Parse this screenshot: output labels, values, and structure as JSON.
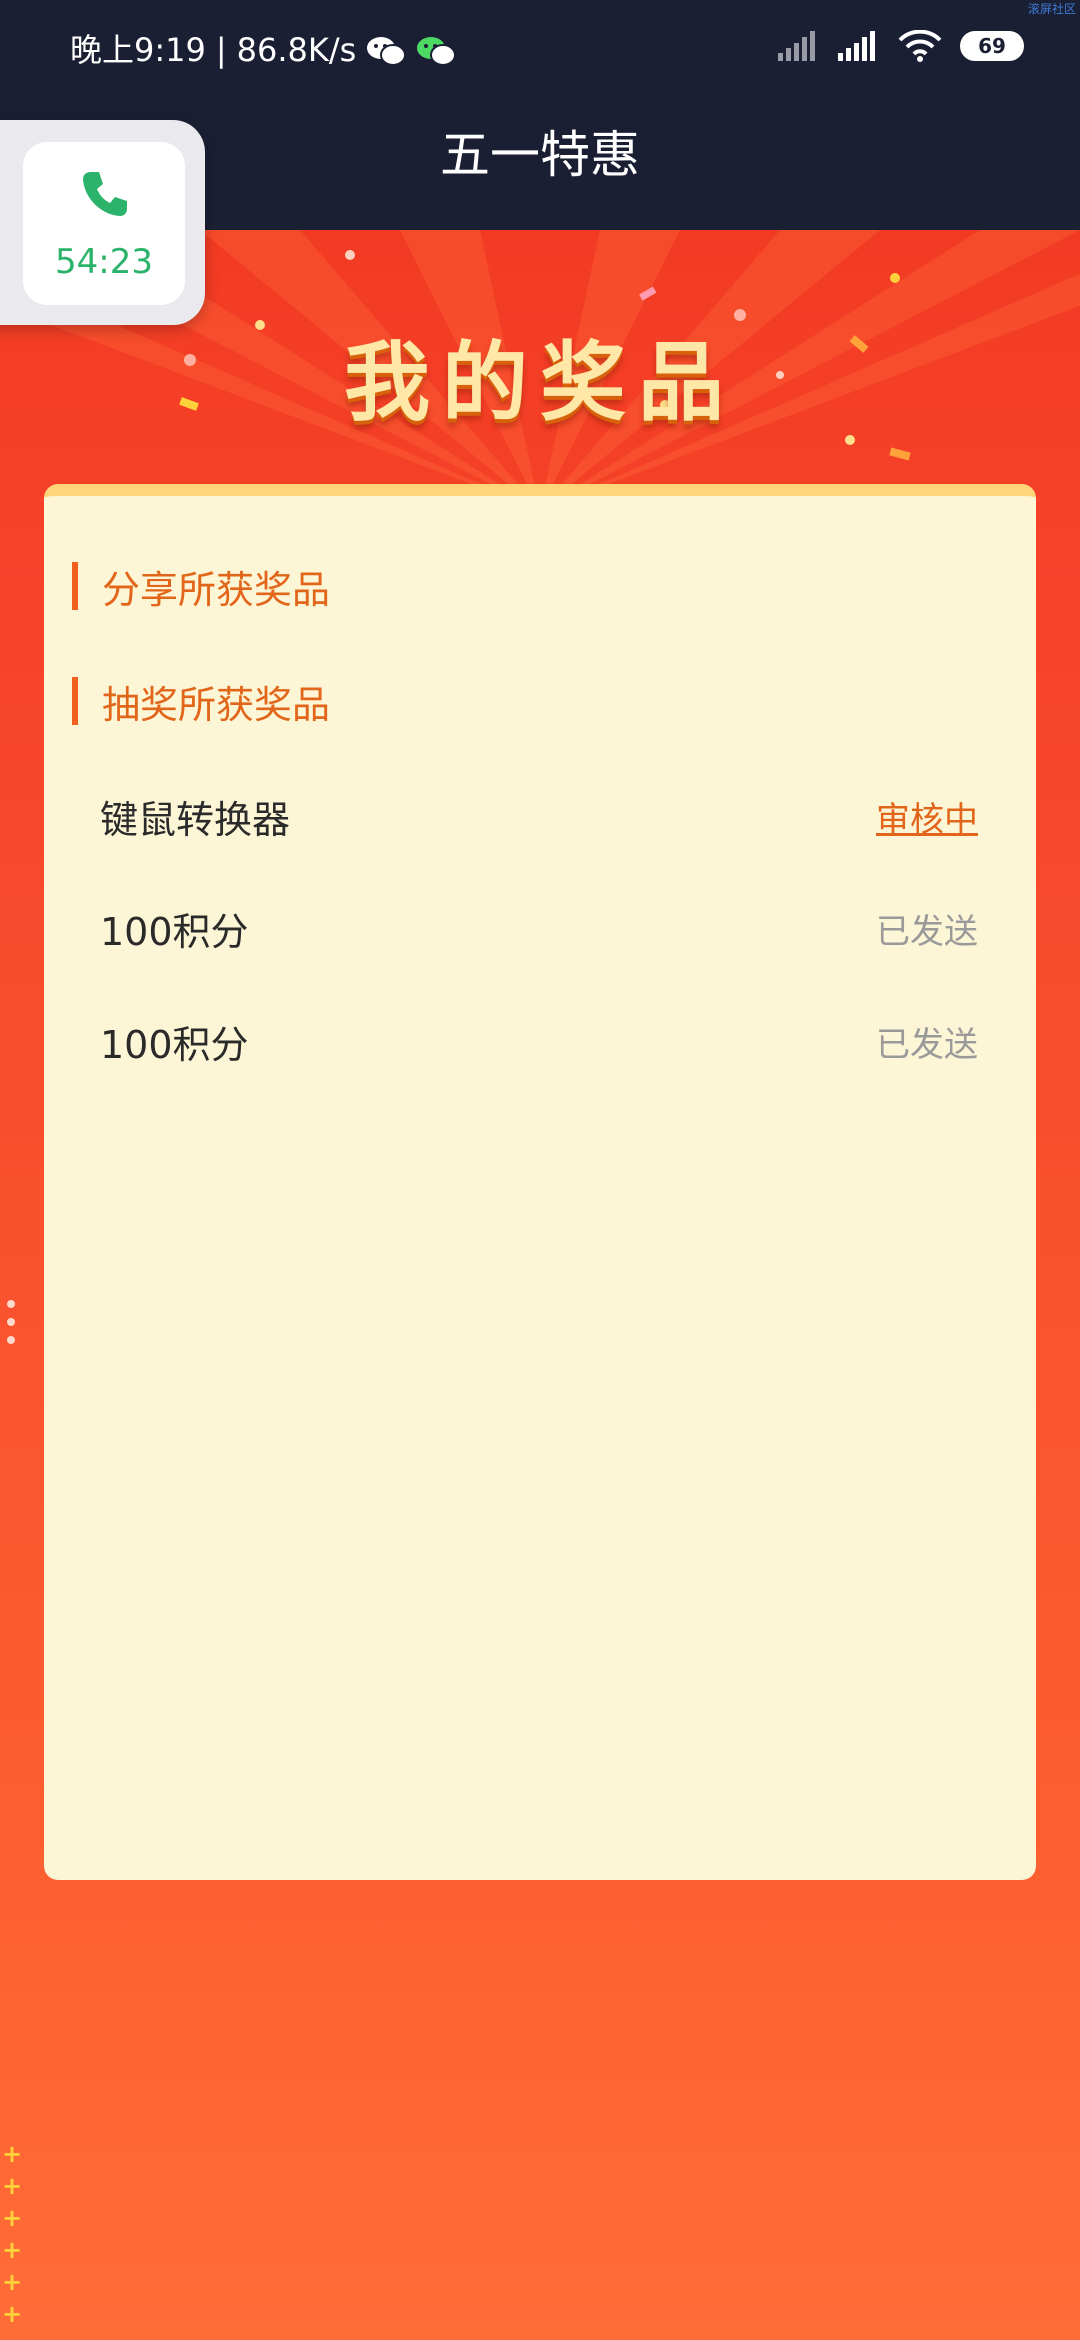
{
  "status_bar": {
    "time": "晚上9:19",
    "separator": "|",
    "network_speed": "86.8K/s",
    "notification_icons": [
      "wechat-icon",
      "wechat-green-icon"
    ],
    "battery_level": "69",
    "watermark": "滚屏社区"
  },
  "header": {
    "title": "五一特惠",
    "back_icon": "back-arrow-icon"
  },
  "call_bubble": {
    "icon": "phone-icon",
    "duration": "54:23"
  },
  "banner": {
    "headline": "我的奖品"
  },
  "prizes": {
    "sections": [
      {
        "title": "分享所获奖品",
        "items": []
      },
      {
        "title": "抽奖所获奖品",
        "items": [
          {
            "name": "键鼠转换器",
            "status": "审核中"
          },
          {
            "name": "100积分",
            "status": "已发送"
          },
          {
            "name": "100积分",
            "status": "已发送"
          }
        ]
      }
    ]
  },
  "colors": {
    "status_bar_bg": "#1b1f33",
    "accent_orange": "#e2661a",
    "card_bg": "#fdf6d6",
    "page_red": "#f0351f",
    "call_green": "#2bb36b"
  }
}
